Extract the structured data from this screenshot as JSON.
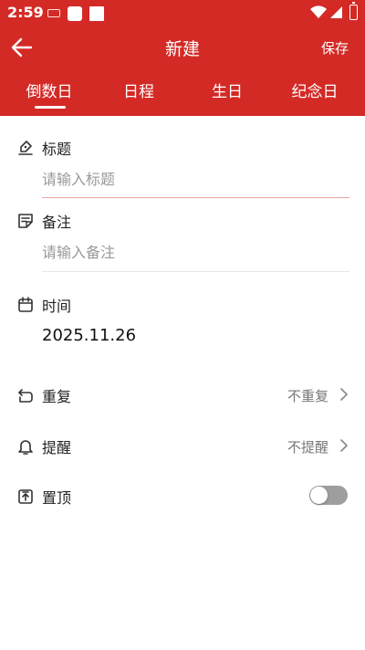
{
  "status_bar": {
    "time": "2:59"
  },
  "toolbar": {
    "title": "新建",
    "save_label": "保存"
  },
  "tabs": [
    {
      "label": "倒数日",
      "active": true
    },
    {
      "label": "日程",
      "active": false
    },
    {
      "label": "生日",
      "active": false
    },
    {
      "label": "纪念日",
      "active": false
    }
  ],
  "form": {
    "title_label": "标题",
    "title_placeholder": "请输入标题",
    "title_value": "",
    "note_label": "备注",
    "note_placeholder": "请输入备注",
    "note_value": "",
    "time_label": "时间",
    "time_value": "2025.11.26",
    "repeat_label": "重复",
    "repeat_value": "不重复",
    "remind_label": "提醒",
    "remind_value": "不提醒",
    "pin_label": "置顶",
    "pin_on": false
  },
  "colors": {
    "accent": "#d32a26",
    "active_divider": "#e8a3a1",
    "divider": "#e6e6e6",
    "toggle_off": "#9e9e9e"
  }
}
